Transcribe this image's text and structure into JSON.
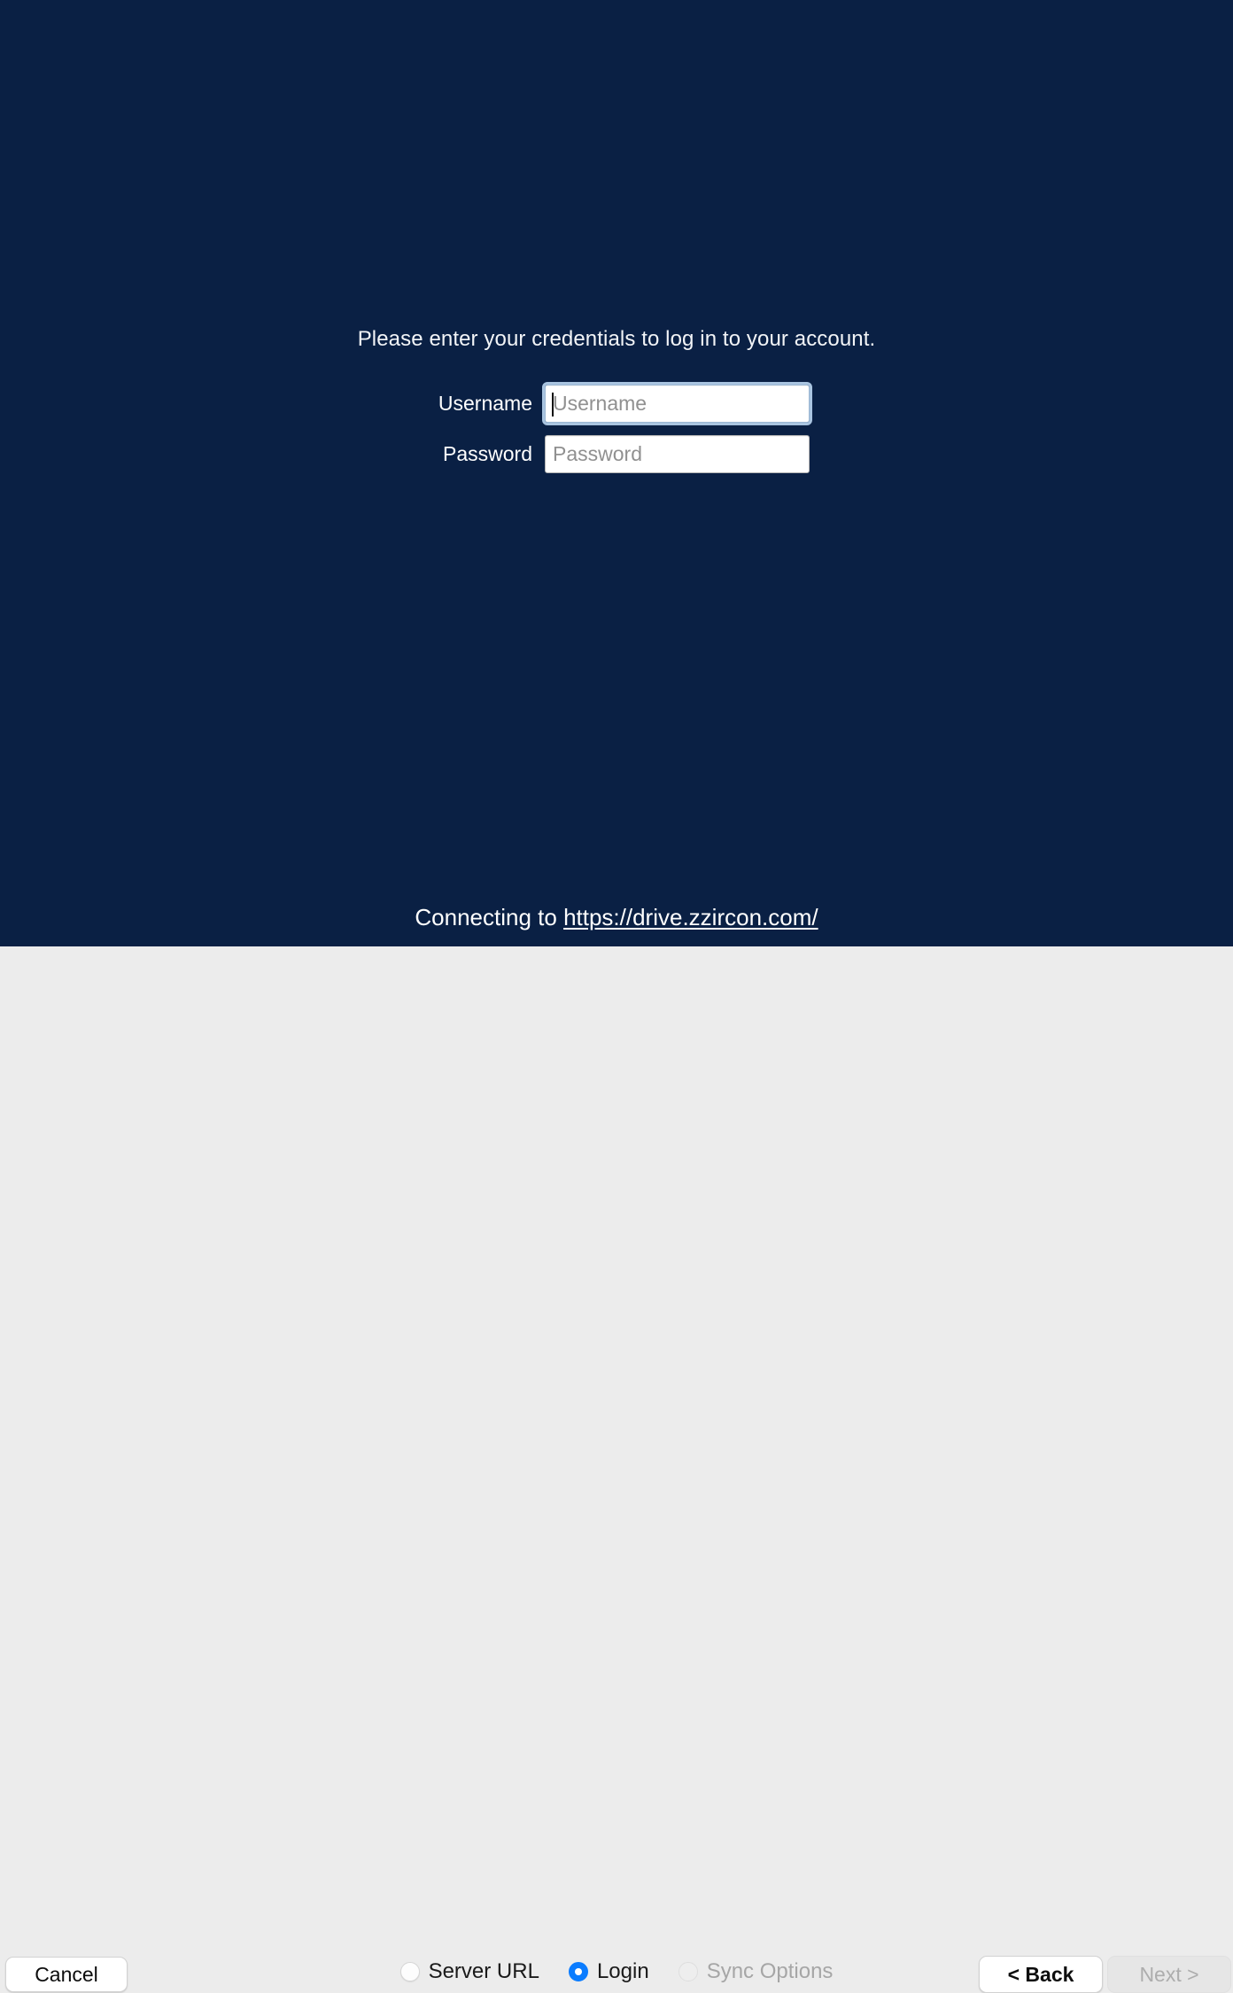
{
  "content": {
    "prompt": "Please enter your credentials to log in to your account.",
    "fields": [
      {
        "label": "Username",
        "value": "",
        "placeholder": "Username",
        "focused": true
      },
      {
        "label": "Password",
        "value": "",
        "placeholder": "Password",
        "focused": false
      }
    ],
    "status": {
      "prefix": "Connecting to ",
      "url": "https://drive.zzircon.com/"
    }
  },
  "footer": {
    "cancel_label": "Cancel",
    "back_label": "< Back",
    "next_label": "Next >",
    "steps": [
      {
        "label": "Server URL",
        "state": "unselected"
      },
      {
        "label": "Login",
        "state": "selected"
      },
      {
        "label": "Sync Options",
        "state": "disabled"
      }
    ]
  },
  "colors": {
    "content_background": "#0a2044",
    "footer_background": "#ececec",
    "accent": "#0a7cff",
    "focus_ring": "#a9c4e0",
    "disabled_text": "#a6a6a6"
  }
}
